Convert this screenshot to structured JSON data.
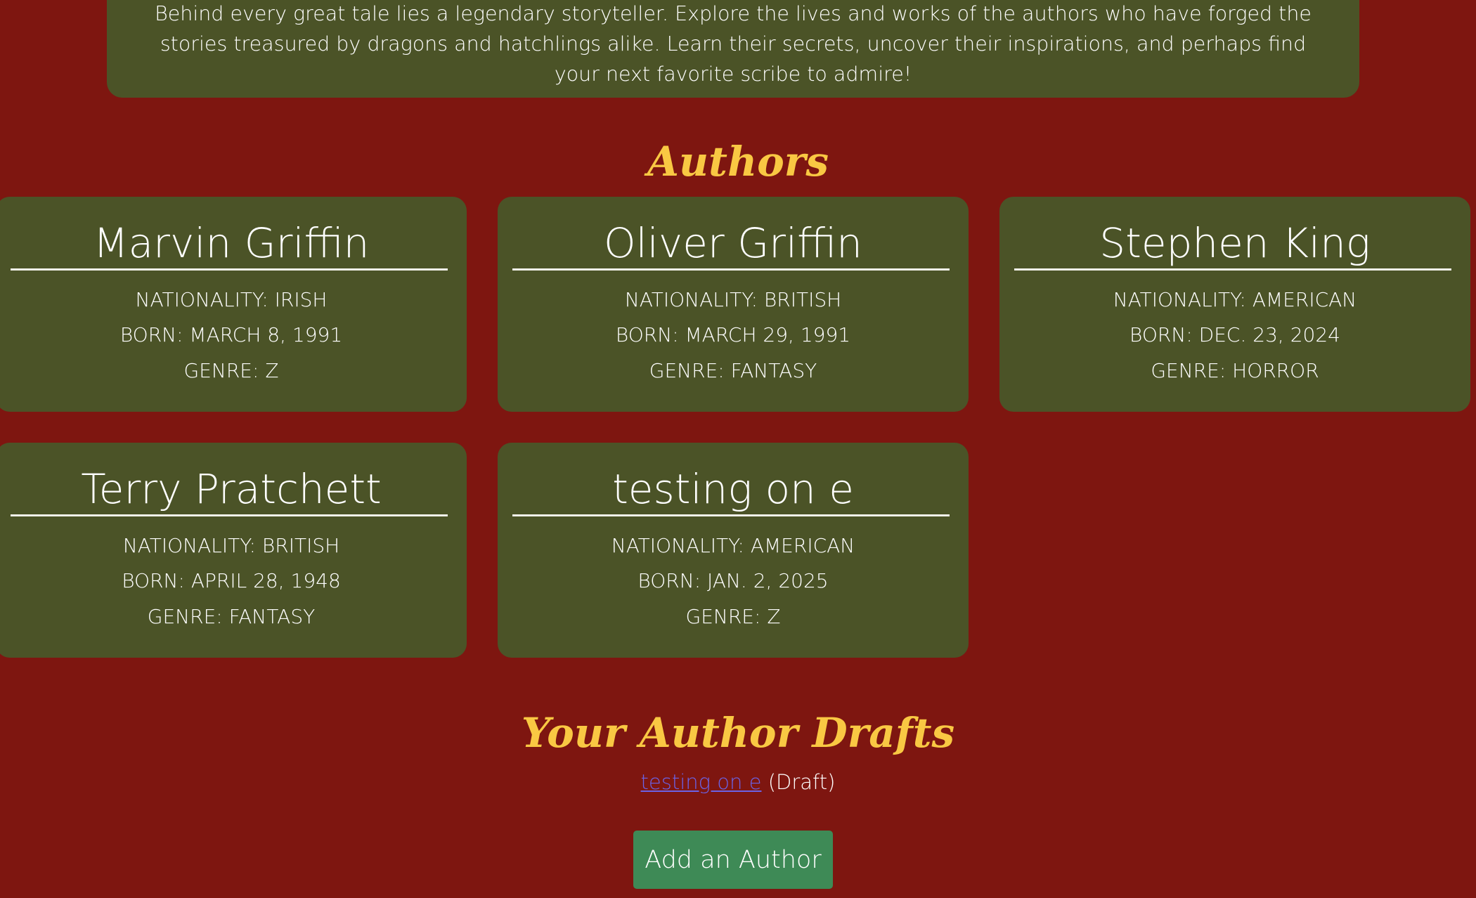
{
  "intro": {
    "text": "Behind every great tale lies a legendary storyteller. Explore the lives and works of the authors who have forged the stories treasured by dragons and hatchlings alike. Learn their secrets, uncover their inspirations, and perhaps find your next favorite scribe to admire!"
  },
  "authors_title": "Authors",
  "authors": [
    {
      "name": "Marvin Griffin",
      "nationality": "NATIONALITY: IRISH",
      "born": "BORN: MARCH 8, 1991",
      "genre": "GENRE: Z"
    },
    {
      "name": "Oliver Griffin",
      "nationality": "NATIONALITY: BRITISH",
      "born": "BORN: MARCH 29, 1991",
      "genre": "GENRE: FANTASY"
    },
    {
      "name": "Stephen King",
      "nationality": "NATIONALITY: AMERICAN",
      "born": "BORN: DEC. 23, 2024",
      "genre": "GENRE: HORROR"
    },
    {
      "name": "Terry Pratchett",
      "nationality": "NATIONALITY: BRITISH",
      "born": "BORN: APRIL 28, 1948",
      "genre": "GENRE: FANTASY"
    },
    {
      "name": "testing on e",
      "nationality": "NATIONALITY: AMERICAN",
      "born": "BORN: JAN. 2, 2025",
      "genre": "GENRE: Z"
    }
  ],
  "drafts": {
    "title": "Your Author Drafts",
    "items": [
      {
        "link_text": "testing on e",
        "suffix": " (Draft)"
      }
    ]
  },
  "add_button_label": "Add an Author",
  "colors": {
    "background": "#7e1610",
    "card": "#4b5327",
    "heading": "#f9c843",
    "link": "#6b63e6",
    "button": "#3e8a56"
  }
}
